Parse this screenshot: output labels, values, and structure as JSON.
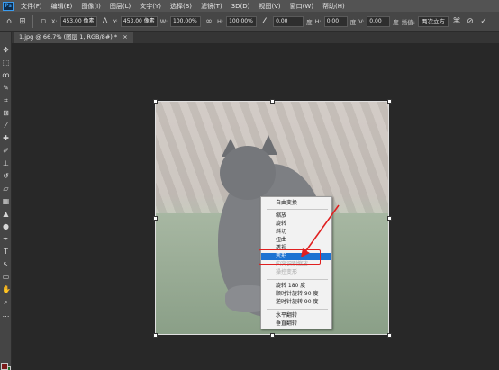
{
  "menubar": {
    "logo": "Ps",
    "items": [
      "文件(F)",
      "编辑(E)",
      "图像(I)",
      "图层(L)",
      "文字(Y)",
      "选择(S)",
      "滤镜(T)",
      "3D(D)",
      "视图(V)",
      "窗口(W)",
      "帮助(H)"
    ]
  },
  "options": {
    "x_label": "X:",
    "x_value": "453.00 像素",
    "y_label": "Y:",
    "y_value": "453.00 像素",
    "w_label": "W:",
    "w_value": "100.00%",
    "h_label": "H:",
    "h_value": "100.00%",
    "angle_value": "0.00",
    "angle_unit": "度",
    "hskew_label": "H:",
    "hskew_value": "0.00",
    "hskew_unit": "度",
    "vskew_label": "V:",
    "vskew_value": "0.00",
    "vskew_unit": "度",
    "interp_label": "插值:",
    "interp_value": "两次立方"
  },
  "tab": {
    "title": "1.jpg @ 66.7% (图层 1, RGB/8#) *",
    "close": "×"
  },
  "context_menu": {
    "items": [
      {
        "label": "自由变换",
        "state": "normal"
      },
      {
        "label": "缩放",
        "state": "normal"
      },
      {
        "label": "旋转",
        "state": "normal"
      },
      {
        "label": "斜切",
        "state": "normal"
      },
      {
        "label": "扭曲",
        "state": "normal"
      },
      {
        "label": "透视",
        "state": "normal"
      },
      {
        "label": "变形",
        "state": "highlight"
      },
      {
        "label": "内容识别缩放",
        "state": "disabled"
      },
      {
        "label": "操控变形",
        "state": "disabled"
      },
      {
        "label": "旋转 180 度",
        "state": "normal"
      },
      {
        "label": "顺时针旋转 90 度",
        "state": "normal"
      },
      {
        "label": "逆时针旋转 90 度",
        "state": "normal"
      },
      {
        "label": "水平翻转",
        "state": "normal"
      },
      {
        "label": "垂直翻转",
        "state": "normal"
      }
    ],
    "highlight_color": "#1c73d2"
  },
  "colors": {
    "annotation": "#e02020",
    "foreground": "#7b1a1a",
    "background": "#1f6b2a"
  }
}
